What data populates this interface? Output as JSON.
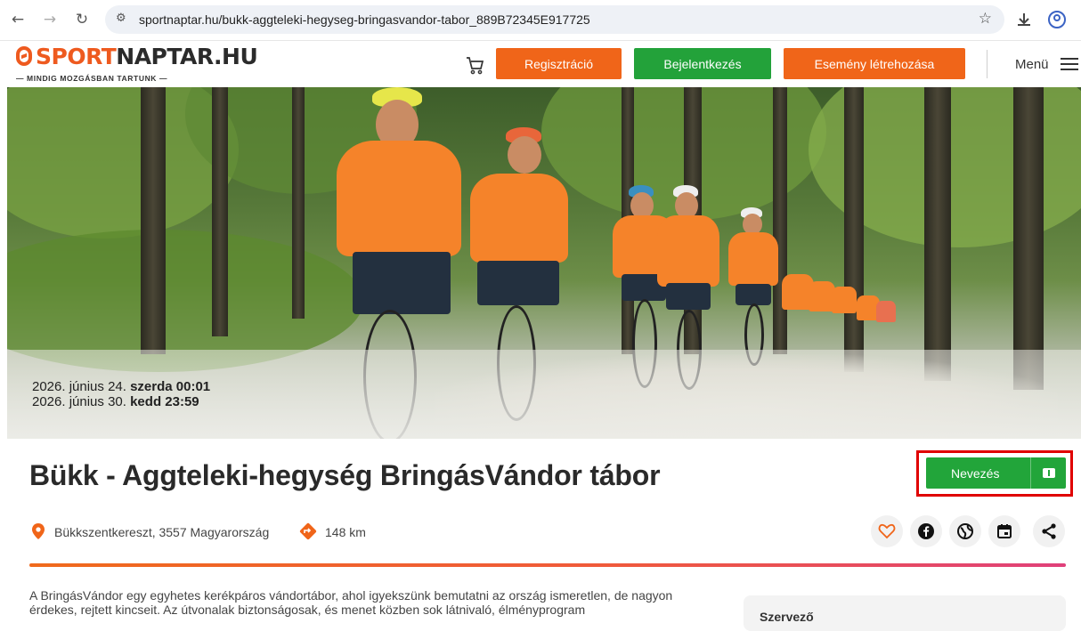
{
  "browser": {
    "url": "sportnaptar.hu/bukk-aggteleki-hegyseg-bringasvandor-tabor_889B72345E917725"
  },
  "header": {
    "logo_main_1": "SPORT",
    "logo_main_2": "NAPTAR.HU",
    "logo_tagline": "— MINDIG MOZGÁSBAN TARTUNK —",
    "register_label": "Regisztráció",
    "login_label": "Bejelentkezés",
    "create_event_label": "Esemény létrehozása",
    "menu_label": "Menü"
  },
  "event": {
    "start_date": "2026. június 24.",
    "start_day_time": "szerda 00:01",
    "end_date": "2026. június 30.",
    "end_day_time": "kedd 23:59",
    "title": "Bükk - Aggteleki-hegység BringásVándor tábor",
    "register_button_label": "Nevezés",
    "location": "Bükkszentkereszt, 3557 Magyarország",
    "distance": "148 km",
    "description": "A BringásVándor egy egyhetes kerékpáros vándortábor, ahol igyekszünk bemutatni az ország ismeretlen, de nagyon érdekes, rejtett kincseit. Az útvonalak biztonságosak, és menet közben sok látnivaló, élményprogram"
  },
  "sidebar": {
    "card_title": "Szervező"
  },
  "colors": {
    "brand_orange": "#f06519",
    "brand_green": "#23a23a",
    "highlight_red": "#e00000"
  },
  "icons": [
    "back-icon",
    "forward-icon",
    "reload-icon",
    "site-settings-icon",
    "star-icon",
    "download-icon",
    "profile-icon",
    "cart-icon",
    "menu-icon",
    "location-pin-icon",
    "distance-icon",
    "heart-icon",
    "facebook-icon",
    "globe-icon",
    "calendar-icon",
    "share-icon",
    "ticket-icon"
  ]
}
